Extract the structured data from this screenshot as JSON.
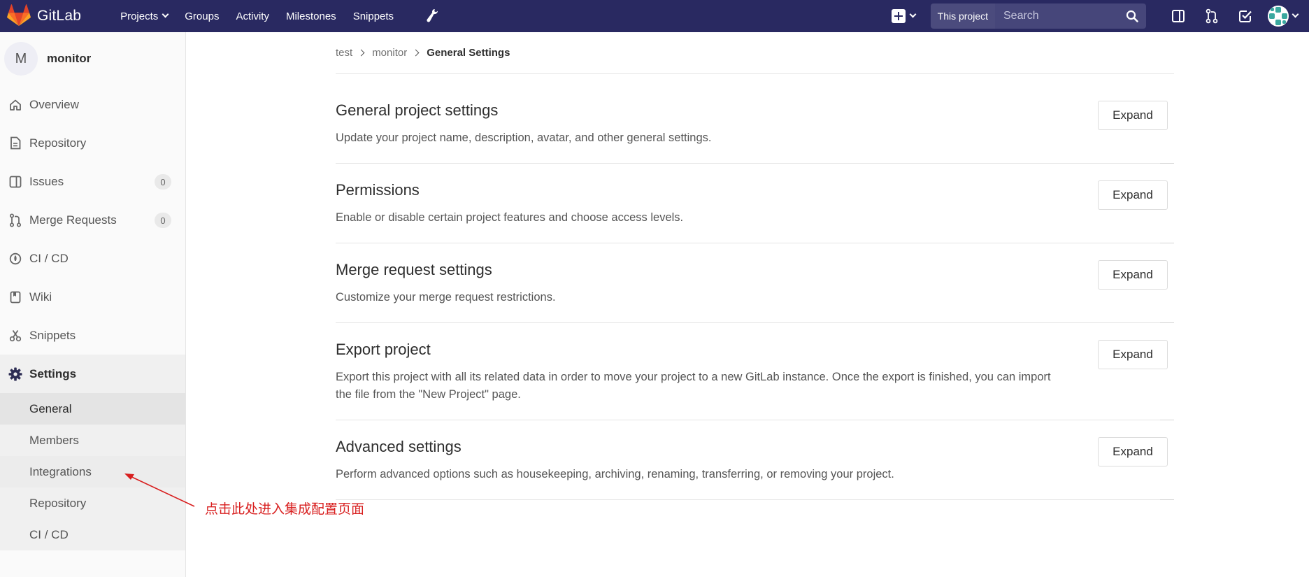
{
  "navbar": {
    "brand": "GitLab",
    "links": [
      {
        "label": "Projects",
        "dropdown": true
      },
      {
        "label": "Groups",
        "dropdown": false
      },
      {
        "label": "Activity",
        "dropdown": false
      },
      {
        "label": "Milestones",
        "dropdown": false
      },
      {
        "label": "Snippets",
        "dropdown": false
      }
    ],
    "search_scope": "This project",
    "search_placeholder": "Search",
    "colors": {
      "bg": "#292961",
      "accent": "#e24329"
    }
  },
  "sidebar": {
    "project_initial": "M",
    "project_name": "monitor",
    "items": [
      {
        "label": "Overview",
        "icon": "home-icon"
      },
      {
        "label": "Repository",
        "icon": "file-icon"
      },
      {
        "label": "Issues",
        "icon": "issues-icon",
        "count": "0"
      },
      {
        "label": "Merge Requests",
        "icon": "merge-request-icon",
        "count": "0"
      },
      {
        "label": "CI / CD",
        "icon": "rocket-icon"
      },
      {
        "label": "Wiki",
        "icon": "book-icon"
      },
      {
        "label": "Snippets",
        "icon": "scissors-icon"
      },
      {
        "label": "Settings",
        "icon": "gear-icon"
      }
    ],
    "settings_sub": [
      "General",
      "Members",
      "Integrations",
      "Repository",
      "CI / CD"
    ]
  },
  "breadcrumb": {
    "items": [
      "test",
      "monitor"
    ],
    "current": "General Settings"
  },
  "sections": [
    {
      "title": "General project settings",
      "desc": "Update your project name, description, avatar, and other general settings.",
      "button": "Expand"
    },
    {
      "title": "Permissions",
      "desc": "Enable or disable certain project features and choose access levels.",
      "button": "Expand"
    },
    {
      "title": "Merge request settings",
      "desc": "Customize your merge request restrictions.",
      "button": "Expand"
    },
    {
      "title": "Export project",
      "desc": "Export this project with all its related data in order to move your project to a new GitLab instance. Once the export is finished, you can import the file from the \"New Project\" page.",
      "button": "Expand"
    },
    {
      "title": "Advanced settings",
      "desc": "Perform advanced options such as housekeeping, archiving, renaming, transferring, or removing your project.",
      "button": "Expand"
    }
  ],
  "annotation": {
    "text": "点击此处进入集成配置页面",
    "color": "#d81e1e"
  }
}
